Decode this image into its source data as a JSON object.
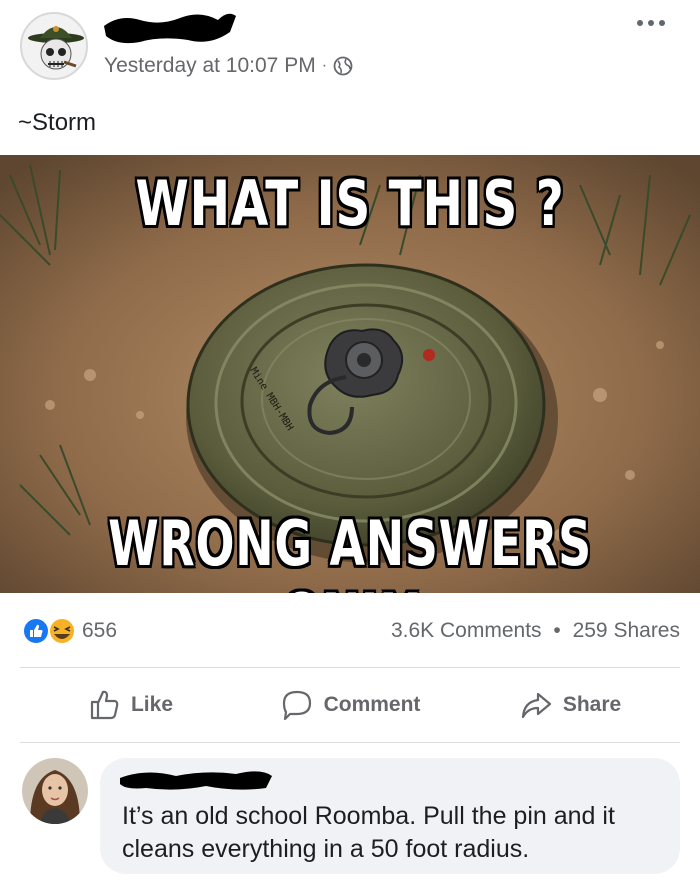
{
  "post": {
    "timestamp": "Yesterday at 10:07 PM",
    "meta_separator": "·",
    "privacy_icon": "globe-icon",
    "more_icon": "more-options-icon",
    "caption": "~Storm"
  },
  "meme": {
    "top_text": "WHAT IS THIS ?",
    "bottom_text": "WRONG ANSWERS ONLY",
    "mine_marking": "Mine MBH-МBH"
  },
  "engagement": {
    "reaction_icons": [
      "like-icon",
      "haha-icon"
    ],
    "reaction_count": "656",
    "comments": "3.6K Comments",
    "separator": "•",
    "shares": "259 Shares"
  },
  "actions": {
    "like": "Like",
    "comment": "Comment",
    "share": "Share"
  },
  "comment": {
    "text": "It’s an old school Roomba.  Pull the pin and it cleans everything in a 50 foot radius."
  },
  "colors": {
    "meta_gray": "#65676b",
    "like_blue": "#1877f2",
    "bubble_bg": "#f0f2f5",
    "divider": "#dadde1"
  }
}
